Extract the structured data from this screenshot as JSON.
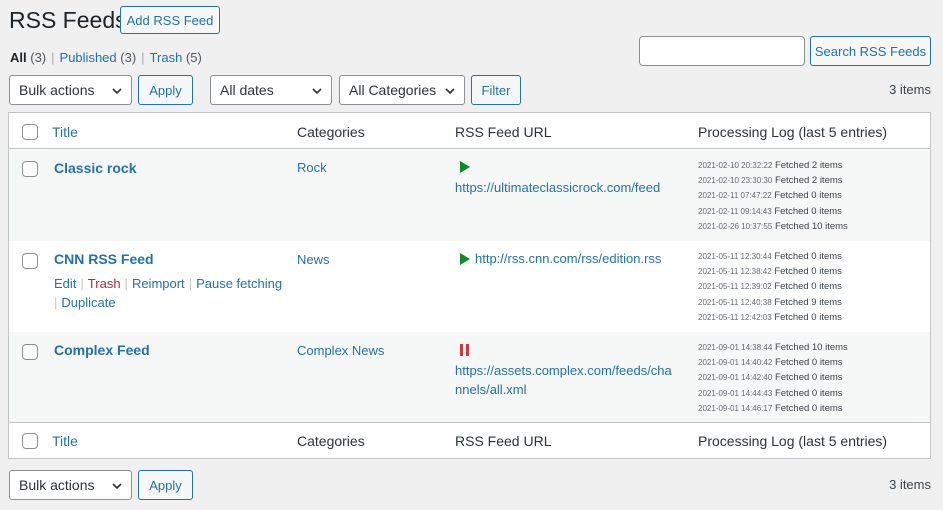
{
  "page": {
    "title": "RSS Feeds",
    "add_button": "Add RSS Feed"
  },
  "views": [
    {
      "label": "All",
      "count": "(3)"
    },
    {
      "label": "Published",
      "count": "(3)"
    },
    {
      "label": "Trash",
      "count": "(5)"
    }
  ],
  "search": {
    "placeholder": "",
    "button": "Search RSS Feeds"
  },
  "top_filters": {
    "bulk": "Bulk actions",
    "apply": "Apply",
    "dates": "All dates",
    "categories": "All Categories",
    "filter": "Filter",
    "items": "3 items"
  },
  "bottom_filters": {
    "bulk": "Bulk actions",
    "apply": "Apply",
    "items": "3 items"
  },
  "columns": {
    "title": "Title",
    "categories": "Categories",
    "url": "RSS Feed URL",
    "log": "Processing Log (last 5 entries)"
  },
  "rows": [
    {
      "title": "Classic rock",
      "category": "Rock",
      "status": "play",
      "url_line1": "https://ultimateclassicrock.com/feed",
      "url_line2": "",
      "log": [
        {
          "ts": "2021-02-10 20:32:22",
          "text": "Fetched 2 items"
        },
        {
          "ts": "2021-02-10 23:30:30",
          "text": "Fetched 2 items"
        },
        {
          "ts": "2021-02-11 07:47:22",
          "text": "Fetched 0 items"
        },
        {
          "ts": "2021-02-11 09:14:43",
          "text": "Fetched 0 items"
        },
        {
          "ts": "2021-02-26 10:37:55",
          "text": "Fetched 10 items"
        }
      ]
    },
    {
      "title": "CNN RSS Feed",
      "category": "News",
      "status": "play",
      "url_line1": "http://rss.cnn.com/rss/edition.rss",
      "url_line2": "",
      "row_actions": {
        "edit": "Edit",
        "trash": "Trash",
        "reimport": "Reimport",
        "pause": "Pause fetching",
        "duplicate": "Duplicate"
      },
      "log": [
        {
          "ts": "2021-05-11 12:30:44",
          "text": "Fetched 0 items"
        },
        {
          "ts": "2021-05-11 12:38:42",
          "text": "Fetched 0 items"
        },
        {
          "ts": "2021-05-11 12:39:02",
          "text": "Fetched 0 items"
        },
        {
          "ts": "2021-05-11 12:40:38",
          "text": "Fetched 9 items"
        },
        {
          "ts": "2021-05-11 12:42:03",
          "text": "Fetched 0 items"
        }
      ]
    },
    {
      "title": "Complex Feed",
      "category": "Complex News",
      "status": "pause",
      "url_line1": "https://assets.complex.com/feeds/cha",
      "url_line2": "nnels/all.xml",
      "log": [
        {
          "ts": "2021-09-01 14:38:44",
          "text": "Fetched 10 items"
        },
        {
          "ts": "2021-09-01 14:40:42",
          "text": "Fetched 0 items"
        },
        {
          "ts": "2021-09-01 14:42:40",
          "text": "Fetched 0 items"
        },
        {
          "ts": "2021-09-01 14:44:43",
          "text": "Fetched 0 items"
        },
        {
          "ts": "2021-09-01 14:46:17",
          "text": "Fetched 0 items"
        }
      ]
    }
  ],
  "colors": {
    "link": "#2271b1",
    "play": "#0a8c27",
    "pause": "#d63638",
    "trash": "#b32d2e"
  }
}
